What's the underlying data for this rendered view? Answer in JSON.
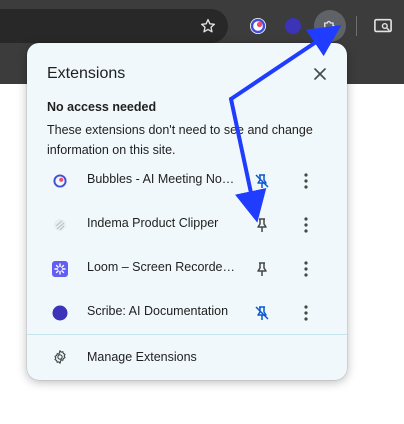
{
  "popup": {
    "title": "Extensions",
    "close_icon": "close-icon",
    "section_heading": "No access needed",
    "section_description": "These extensions don't need to see and change information on this site."
  },
  "extensions": [
    {
      "name": "Bubbles - AI Meeting Notes",
      "icon": "bubbles-icon",
      "pinned": true
    },
    {
      "name": "Indema Product Clipper",
      "icon": "indema-icon",
      "pinned": false
    },
    {
      "name": "Loom – Screen Recorder & Screen Capture",
      "icon": "loom-icon",
      "pinned": false
    },
    {
      "name": "Scribe: AI Documentation",
      "icon": "scribe-icon",
      "pinned": true
    }
  ],
  "manage": {
    "label": "Manage Extensions",
    "icon": "gear-icon"
  },
  "toolbar": {
    "icons": [
      "star-icon",
      "bubbles-icon",
      "scribe-icon",
      "extensions-puzzle-icon",
      "media-router-icon"
    ]
  },
  "colors": {
    "accent_blue": "#0b57d0",
    "annotation_arrow": "#1f3cff",
    "popup_bg": "#f1f8fb",
    "toolbar_bg": "#3c3c3c"
  }
}
